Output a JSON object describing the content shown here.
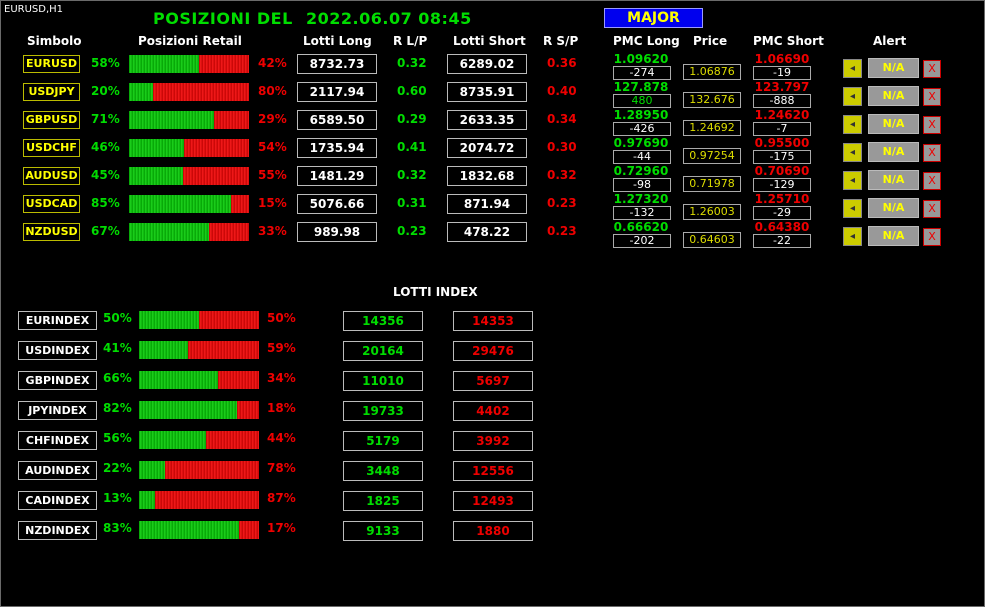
{
  "window_title": "EURUSD,H1",
  "header": {
    "title_prefix": "POSIZIONI  DEL",
    "date": "2022.06.07 08:45",
    "major_button": "MAJOR"
  },
  "columns": {
    "symbol": "Simbolo",
    "retail": "Posizioni Retail",
    "lots_long": "Lotti Long",
    "r_lp": "R L/P",
    "lots_short": "Lotti Short",
    "r_sp": "R S/P",
    "pmc_long": "PMC Long",
    "price": "Price",
    "pmc_short": "PMC Short",
    "alert": "Alert"
  },
  "alert_labels": {
    "na": "N/A",
    "close": "X"
  },
  "pairs": [
    {
      "symbol": "EURUSD",
      "long_pct": "58%",
      "long_frac": 0.58,
      "short_pct": "42%",
      "lots_long": "8732.73",
      "r_lp": "0.32",
      "lots_short": "6289.02",
      "r_sp": "0.36",
      "pmc_long": "1.09620",
      "pmc_long_diff": "-274",
      "price": "1.06876",
      "pmc_short": "1.06690",
      "pmc_short_diff": "-19"
    },
    {
      "symbol": "USDJPY",
      "long_pct": "20%",
      "long_frac": 0.2,
      "short_pct": "80%",
      "lots_long": "2117.94",
      "r_lp": "0.60",
      "lots_short": "8735.91",
      "r_sp": "0.40",
      "pmc_long": "127.878",
      "pmc_long_diff": "480",
      "price": "132.676",
      "pmc_short": "123.797",
      "pmc_short_diff": "-888"
    },
    {
      "symbol": "GBPUSD",
      "long_pct": "71%",
      "long_frac": 0.71,
      "short_pct": "29%",
      "lots_long": "6589.50",
      "r_lp": "0.29",
      "lots_short": "2633.35",
      "r_sp": "0.34",
      "pmc_long": "1.28950",
      "pmc_long_diff": "-426",
      "price": "1.24692",
      "pmc_short": "1.24620",
      "pmc_short_diff": "-7"
    },
    {
      "symbol": "USDCHF",
      "long_pct": "46%",
      "long_frac": 0.46,
      "short_pct": "54%",
      "lots_long": "1735.94",
      "r_lp": "0.41",
      "lots_short": "2074.72",
      "r_sp": "0.30",
      "pmc_long": "0.97690",
      "pmc_long_diff": "-44",
      "price": "0.97254",
      "pmc_short": "0.95500",
      "pmc_short_diff": "-175"
    },
    {
      "symbol": "AUDUSD",
      "long_pct": "45%",
      "long_frac": 0.45,
      "short_pct": "55%",
      "lots_long": "1481.29",
      "r_lp": "0.32",
      "lots_short": "1832.68",
      "r_sp": "0.32",
      "pmc_long": "0.72960",
      "pmc_long_diff": "-98",
      "price": "0.71978",
      "pmc_short": "0.70690",
      "pmc_short_diff": "-129"
    },
    {
      "symbol": "USDCAD",
      "long_pct": "85%",
      "long_frac": 0.85,
      "short_pct": "15%",
      "lots_long": "5076.66",
      "r_lp": "0.31",
      "lots_short": "871.94",
      "r_sp": "0.23",
      "pmc_long": "1.27320",
      "pmc_long_diff": "-132",
      "price": "1.26003",
      "pmc_short": "1.25710",
      "pmc_short_diff": "-29"
    },
    {
      "symbol": "NZDUSD",
      "long_pct": "67%",
      "long_frac": 0.67,
      "short_pct": "33%",
      "lots_long": "989.98",
      "r_lp": "0.23",
      "lots_short": "478.22",
      "r_sp": "0.23",
      "pmc_long": "0.66620",
      "pmc_long_diff": "-202",
      "price": "0.64603",
      "pmc_short": "0.64380",
      "pmc_short_diff": "-22"
    }
  ],
  "lots_index_title": "LOTTI INDEX",
  "indices": [
    {
      "name": "EURINDEX",
      "long_pct": "50%",
      "long_frac": 0.5,
      "short_pct": "50%",
      "long_lots": "14356",
      "short_lots": "14353"
    },
    {
      "name": "USDINDEX",
      "long_pct": "41%",
      "long_frac": 0.41,
      "short_pct": "59%",
      "long_lots": "20164",
      "short_lots": "29476"
    },
    {
      "name": "GBPINDEX",
      "long_pct": "66%",
      "long_frac": 0.66,
      "short_pct": "34%",
      "long_lots": "11010",
      "short_lots": "5697"
    },
    {
      "name": "JPYINDEX",
      "long_pct": "82%",
      "long_frac": 0.82,
      "short_pct": "18%",
      "long_lots": "19733",
      "short_lots": "4402"
    },
    {
      "name": "CHFINDEX",
      "long_pct": "56%",
      "long_frac": 0.56,
      "short_pct": "44%",
      "long_lots": "5179",
      "short_lots": "3992"
    },
    {
      "name": "AUDINDEX",
      "long_pct": "22%",
      "long_frac": 0.22,
      "short_pct": "78%",
      "long_lots": "3448",
      "short_lots": "12556"
    },
    {
      "name": "CADINDEX",
      "long_pct": "13%",
      "long_frac": 0.13,
      "short_pct": "87%",
      "long_lots": "1825",
      "short_lots": "12493"
    },
    {
      "name": "NZDINDEX",
      "long_pct": "83%",
      "long_frac": 0.83,
      "short_pct": "17%",
      "long_lots": "9133",
      "short_lots": "1880"
    }
  ],
  "colors": {
    "long": "#00dd00",
    "short": "#ee0000",
    "symbol": "#ffff00",
    "price": "#dddd00",
    "major_bg": "#0000ee"
  }
}
